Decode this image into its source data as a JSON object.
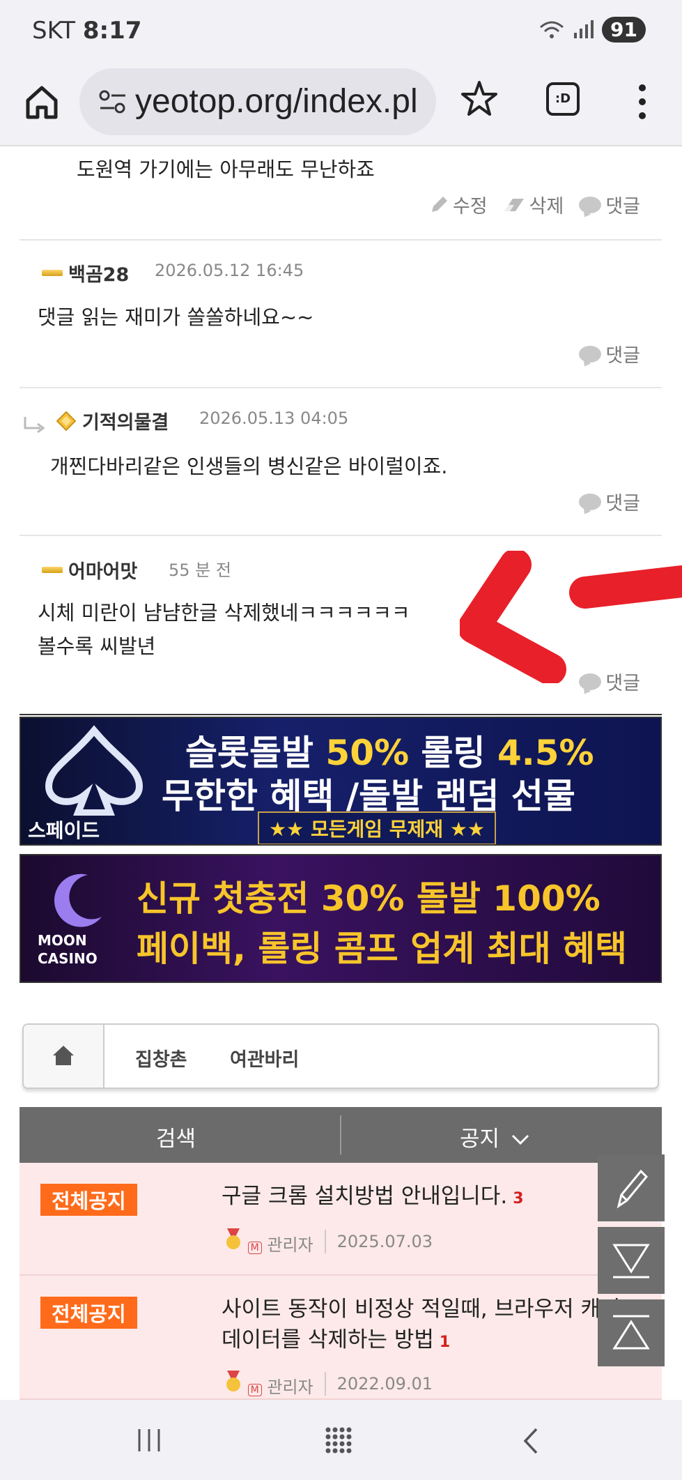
{
  "status_bar": {
    "carrier": "SKT",
    "time": "8:17",
    "battery": "91"
  },
  "browser": {
    "url": "yeotop.org/index.pl",
    "tabs_label": ":D"
  },
  "comments": [
    {
      "text": "도원역 가기에는 아무래도 무난하죠",
      "actions": [
        "수정",
        "삭제",
        "댓글"
      ]
    },
    {
      "author": "백곰28",
      "date": "2026.05.12 16:45",
      "text": "댓글 읽는 재미가 쏠쏠하네요~~",
      "reply_label": "댓글"
    },
    {
      "author": "기적의물결",
      "date": "2026.05.13 04:05",
      "text": "개찐다바리같은 인생들의 병신같은 바이럴이죠.",
      "reply_label": "댓글"
    },
    {
      "author": "어마어맛",
      "date": "55 분 전",
      "text_line1": "시체 미란이 냠냠한글 삭제했네ㅋㅋㅋㅋㅋㅋ",
      "text_line2": "볼수록 씨발년",
      "reply_label": "댓글"
    }
  ],
  "banners": [
    {
      "brand": "스페이드",
      "line1_a": "슬롯돌발 ",
      "line1_b": "50%",
      "line1_c": " 롤링 ",
      "line1_d": "4.5%",
      "line2": "무한한 혜택 /돌발 랜덤 선물",
      "line3_a": "★★ 모든게임 ",
      "line3_b": "무제재",
      "line3_c": " ★★"
    },
    {
      "brand_top": "MOON",
      "brand_bottom": "CASINO",
      "line1": "신규 첫충전 30% 돌발 100%",
      "line2": "페이백, 롤링 콤프 업계 최대 혜택"
    }
  ],
  "nav": {
    "items": [
      "집창촌",
      "여관바리"
    ]
  },
  "board": {
    "search_label": "검색",
    "notice_label": "공지"
  },
  "notices": [
    {
      "badge": "전체공지",
      "title": "구글 크롬 설치방법 안내입니다.",
      "count": "3",
      "author": "관리자",
      "date": "2025.07.03"
    },
    {
      "badge": "전체공지",
      "title_line1": "사이트 동작이 비정상 적일때, 브라우저 캐시",
      "title_line2": "데이터를 삭제하는 방법",
      "count": "1",
      "author": "관리자",
      "date": "2022.09.01"
    }
  ],
  "colors": {
    "notice_badge": "#ff6b1a",
    "notice_bg": "#fde9e9",
    "board_header": "#6b6b6b",
    "annotation": "#e8202a"
  }
}
